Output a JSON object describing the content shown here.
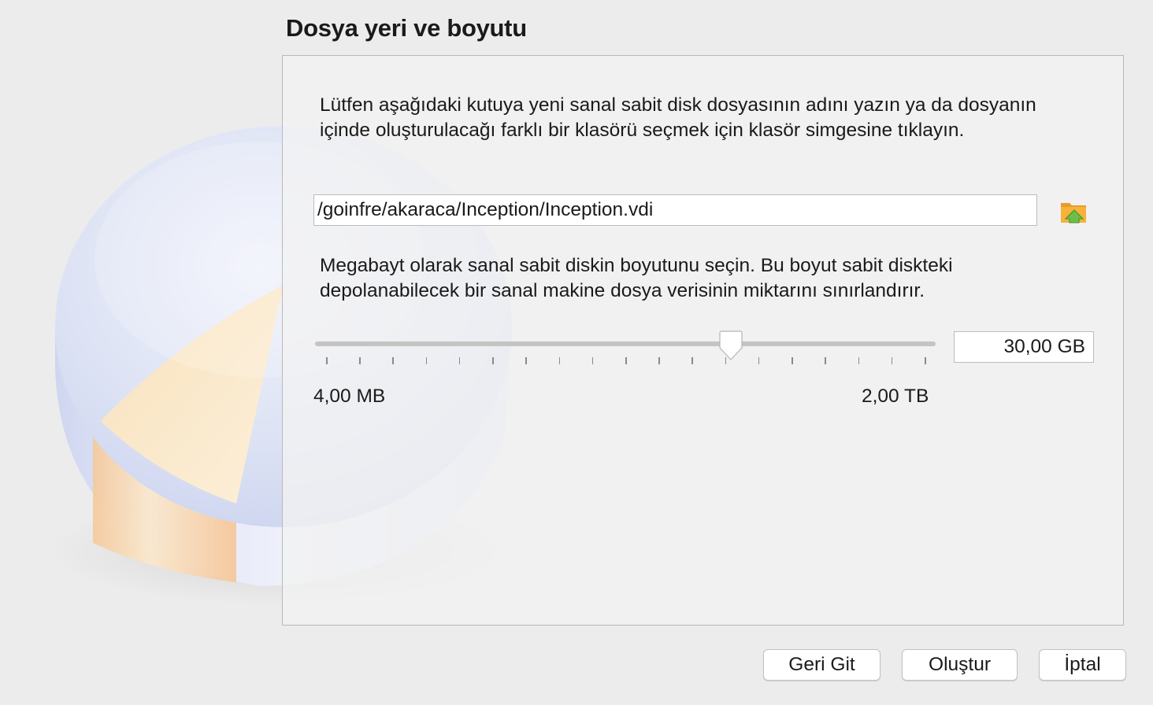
{
  "page": {
    "title": "Dosya yeri ve boyutu"
  },
  "location": {
    "description": "Lütfen aşağıdaki kutuya yeni sanal sabit disk dosyasının adını yazın ya da dosyanın içinde oluşturulacağı farklı bir klasörü seçmek için klasör simgesine tıklayın.",
    "file_path": "/goinfre/akaraca/Inception/Inception.vdi",
    "folder_icon": "folder-browse-icon"
  },
  "size": {
    "description": "Megabayt olarak sanal sabit diskin boyutunu seçin. Bu boyut sabit diskteki depolanabilecek bir sanal makine dosya verisinin miktarını sınırlandırır.",
    "value": "30,00 GB",
    "min_label": "4,00 MB",
    "max_label": "2,00 TB",
    "slider_position": 0.67,
    "tick_count": 19
  },
  "buttons": {
    "back": "Geri Git",
    "create": "Oluştur",
    "cancel": "İptal"
  },
  "colors": {
    "accent_orange": "#f6b23a",
    "folder_green": "#6cc04a",
    "disk_blue": "#c7d0ec",
    "disk_orange": "#f7d7a7"
  }
}
